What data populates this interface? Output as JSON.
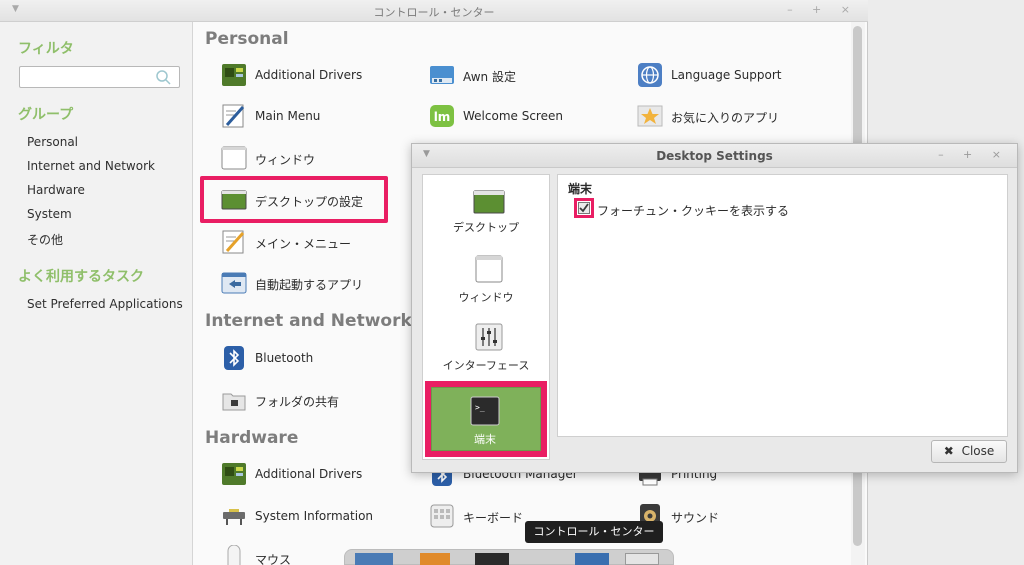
{
  "window": {
    "title": "コントロール・センター",
    "buttons": "– + ×"
  },
  "sidebar": {
    "filter_heading": "フィルタ",
    "group_heading": "グループ",
    "groups": [
      "Personal",
      "Internet and Network",
      "Hardware",
      "System",
      "その他"
    ],
    "tasks_heading": "よく利用するタスク",
    "tasks": [
      "Set Preferred Applications"
    ]
  },
  "sections": {
    "personal": "Personal",
    "internet": "Internet and Network",
    "hardware": "Hardware"
  },
  "personal_items": {
    "additional_drivers": "Additional Drivers",
    "awn": "Awn 設定",
    "language_support": "Language Support",
    "main_menu": "Main Menu",
    "welcome_screen": "Welcome Screen",
    "favorite_apps": "お気に入りのアプリ",
    "window": "ウィンドウ",
    "desktop_settings": "デスクトップの設定",
    "main_menu_jp": "メイン・メニュー",
    "autostart": "自動起動するアプリ"
  },
  "internet_items": {
    "bluetooth": "Bluetooth",
    "folder_share": "フォルダの共有"
  },
  "hardware_items": {
    "additional_drivers": "Additional Drivers",
    "bluetooth_manager": "Bluetooth Manager",
    "printing": "Printing",
    "system_info": "System Information",
    "keyboard": "キーボード",
    "sound": "サウンド",
    "mouse": "マウス"
  },
  "dialog": {
    "title": "Desktop Settings",
    "buttons": "– + ×",
    "side_items": [
      "デスクトップ",
      "ウィンドウ",
      "インターフェース",
      "端末"
    ],
    "panel_heading": "端末",
    "checkbox_label": "フォーチュン・クッキーを表示する",
    "checkbox_checked": true,
    "close_label": "Close",
    "close_icon": "✖"
  },
  "tooltip": "コントロール・センター",
  "colors": {
    "highlight": "#e91e63",
    "accent_green": "#8fbf6a",
    "selected_green": "#7fb15a"
  }
}
